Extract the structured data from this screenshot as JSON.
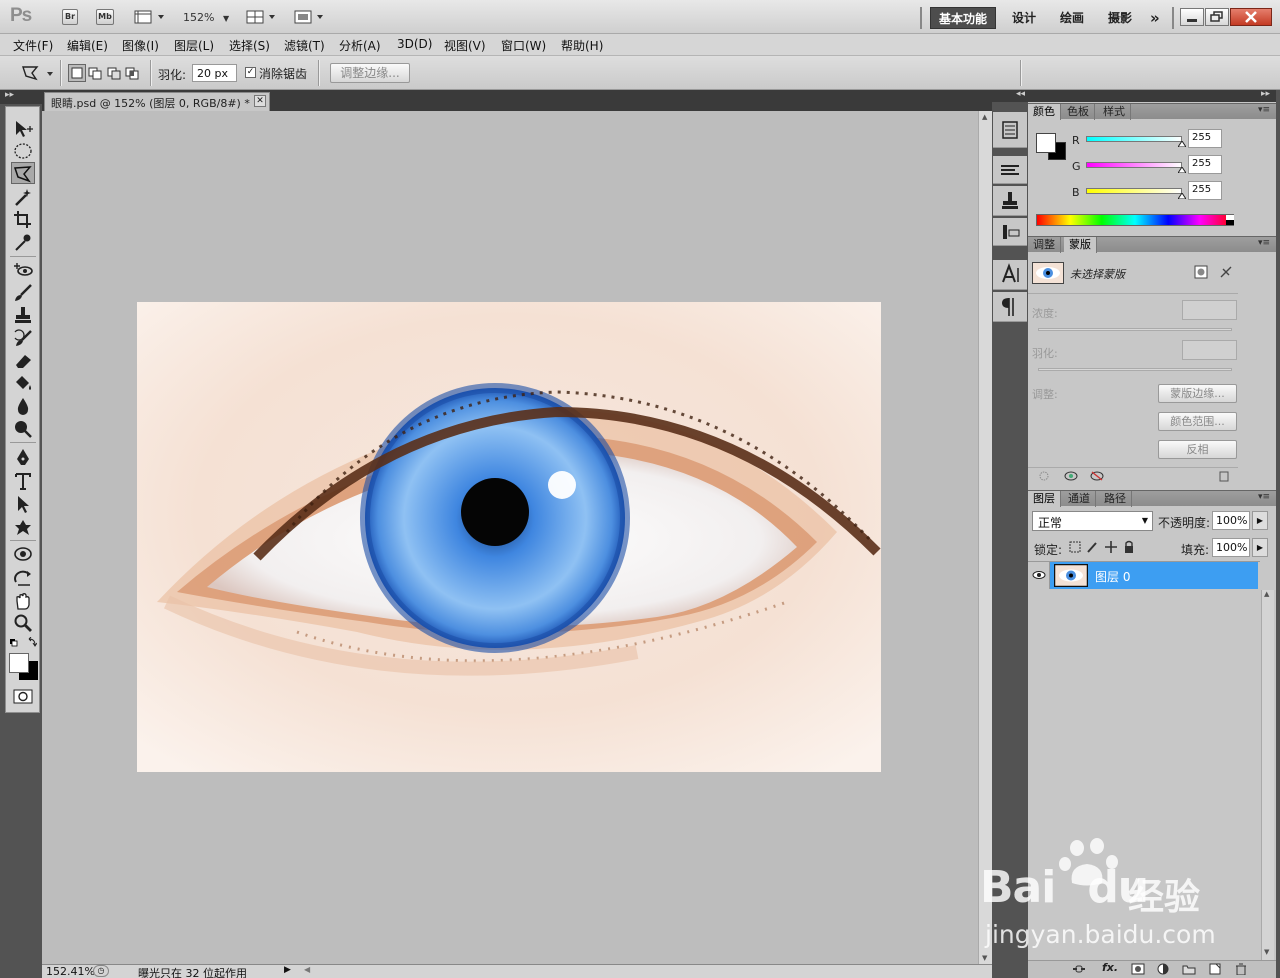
{
  "app": {
    "logo": "Ps",
    "bridge_button": "Br",
    "minibridge_button": "Mb",
    "zoom_level": "152%"
  },
  "workspaces": [
    "基本功能",
    "设计",
    "绘画",
    "摄影"
  ],
  "workspaces_more": "»",
  "menus": [
    "文件(F)",
    "编辑(E)",
    "图像(I)",
    "图层(L)",
    "选择(S)",
    "滤镜(T)",
    "分析(A)",
    "3D(D)",
    "视图(V)",
    "窗口(W)",
    "帮助(H)"
  ],
  "options": {
    "feather_label": "羽化:",
    "feather_value": "20 px",
    "antialias_label": "消除锯齿",
    "antialias_checked": true,
    "refine_edge_button": "调整边缘..."
  },
  "document": {
    "tab_title": "眼睛.psd @ 152% (图层 0, RGB/8#) *",
    "status_zoom": "152.41%",
    "status_text": "曝光只在 32 位起作用"
  },
  "color_panel": {
    "tabs": [
      "颜色",
      "色板",
      "样式"
    ],
    "channels": [
      {
        "name": "R",
        "value": "255",
        "color": "#00ffff"
      },
      {
        "name": "G",
        "value": "255",
        "color": "#ff00ff"
      },
      {
        "name": "B",
        "value": "255",
        "color": "#ffff00"
      }
    ],
    "foreground": "#ffffff",
    "background": "#000000"
  },
  "masks_panel": {
    "tabs": [
      "调整",
      "蒙版"
    ],
    "status": "未选择蒙版",
    "density_label": "浓度:",
    "feather_label": "羽化:",
    "refine_label": "调整:",
    "mask_edge_button": "蒙版边缘...",
    "color_range_button": "颜色范围...",
    "invert_button": "反相"
  },
  "layers_panel": {
    "tabs": [
      "图层",
      "通道",
      "路径"
    ],
    "blend_mode": "正常",
    "opacity_label": "不透明度:",
    "opacity_value": "100%",
    "lock_label": "锁定:",
    "fill_label": "填充:",
    "fill_value": "100%",
    "layers": [
      {
        "name": "图层 0",
        "selected": true,
        "visible": true
      }
    ],
    "fx_label": "fx."
  },
  "watermark": {
    "brand": "Bai",
    "brand_tail": "du",
    "cn": "经验",
    "url": "jingyan.baidu.com"
  }
}
